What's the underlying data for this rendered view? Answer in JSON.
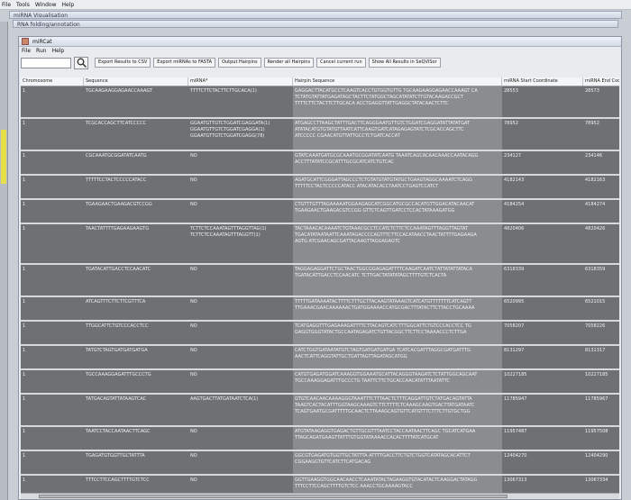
{
  "outer_window": {
    "title": "sRNA Workbench",
    "menu": [
      "File",
      "Tools",
      "Window",
      "Help"
    ],
    "bg_windows": [
      "miRNA Visualisation",
      "RNA folding/annotation"
    ]
  },
  "main_window": {
    "title": "miRCat",
    "menu": [
      "File",
      "Run",
      "Help"
    ],
    "search": {
      "placeholder": "",
      "value": ""
    },
    "toolbar": [
      "Export Results to CSV",
      "Export miRNAs to FASTA",
      "Output Hairpins",
      "Render all Hairpins",
      "Cancel current run",
      "Show All Results in SeQVISor"
    ]
  },
  "table": {
    "columns": [
      "Chromosome",
      "Sequence",
      "miRNA*",
      "Hairpin Sequence",
      "miRNA Start Coordinate",
      "miRNA End Coord"
    ],
    "rows": [
      {
        "chrom": "1",
        "seq": "TGCAAGAAGGAGAACCAAAGT",
        "star": [
          "TTTTCTTCTACTTCTTGCACA(1)"
        ],
        "hairpin": [
          "GAGGACTTACATGCCTCAAGTCACCTGTGGTGTTG TGCAAGAAGGAGAACCAAAGT CA",
          "TCTATGTATTATGAGATAGCTACTTCTATGGCTAGCATATATCTTGTACAAGACCGCT",
          "TTTTCTTCTACTTCTTGCACA ACCTGAGGTTATTGAGGCTATACAACTCTTC"
        ],
        "start": "28553",
        "end": "28573"
      },
      {
        "chrom": "1",
        "seq": "TCGCACCAGCTTCATCCCCC",
        "star": [
          "GGAATGTTGTCTGGATCGAGGATA(1)",
          "GGAATGTTGTCTGGATCGAGGA(1)",
          "GGAATGTTGTCTGGATCGAGG(78)"
        ],
        "hairpin": [
          "ATGAGCCTTAAGCTATTTGACTTCAGGGAATGTTGTCTGGATCGAGGATATTATATGAT",
          "ATATACATGTGTATGTTAATCATTCAAGTGATCATAGAGAGTATCTCGCACCAGCTTC",
          "ATCCCCC CGAACATGTTATTGCCTCTGATCACCAT"
        ],
        "start": "78952",
        "end": "78952"
      },
      {
        "chrom": "1",
        "seq": "CGCAAATGCGGATATCAATG",
        "star": [
          "NO"
        ],
        "hairpin": [
          "GTATCAAATGATGCGCAAATGCGGATATCAATG TAAATCAGCACAACAAACCAATACAGG",
          "ACCTTTATATCCGCATTTGCGCATCATCTGTCAC"
        ],
        "start": "234127",
        "end": "234146"
      },
      {
        "chrom": "1",
        "seq": "TTTTTCCTACTCCCCCATACC",
        "star": [
          "NO"
        ],
        "hairpin": [
          "AGATGCATTCGGGATTAGCCCTCTGTATGTATGTATGCTGAAGTAGGCAAAATCTCAGG",
          "TTTTTCCTACTCCCCCATACC ATACATACACCTAATCCTGAGTCCATCT"
        ],
        "start": "4182143",
        "end": "4182163"
      },
      {
        "chrom": "1",
        "seq": "TGAAGAACTGAAGACGTCCGG",
        "star": [
          "NO"
        ],
        "hairpin": [
          "CTGTTTGTTTAGAAAAATGGAAGAGCATCGGCATGCGCCACATGTTGGACATACAACAT",
          "TGAAGAACTGAAGACGTCCGG GTTCTCAGTTGATCCTCCACTATAAAGATGG"
        ],
        "start": "4184254",
        "end": "4184274"
      },
      {
        "chrom": "1",
        "seq": "TAACTATTTTGAGAAGAAGTG",
        "star": [
          "TCTTCTCCAAATAGTTTAGGTTAG(1)",
          "TCTTCTCCAAATAGTTTAGGTT(1)"
        ],
        "hairpin": [
          "TACTAAACACAAAATCTGTAAACGCCTCCATCTCTTCTCCAAATAGTTTAGGTTAGTAT",
          "TGACATATAATAATTCAAATAGACCCCAGTTTCTTCCACATAACCTAACTATTTTGAGAAGA",
          "AGTG ATCGAACAGCGATTACAAGTTAGGAGAGTC"
        ],
        "start": "4820406",
        "end": "4820426"
      },
      {
        "chrom": "1",
        "seq": "TGATACATTGACCTCCAACATC",
        "star": [
          "NO"
        ],
        "hairpin": [
          "TAGGAGAGGATTCTGCTAACTGGCGGAGAGATTTTCAAGATCAATCTATTATATTATACA",
          "TGATACATTGACCTCCAACATC TCTTGACTATATATAGCTTTTGTCTCACTA"
        ],
        "start": "6318339",
        "end": "6318359"
      },
      {
        "chrom": "1",
        "seq": "ATCAGTTTCTTCTTCGTTTCA",
        "star": [
          "NO"
        ],
        "hairpin": [
          "TTTTTGATAAAATACTTTTCTTTGCTTACAAGTATAAAGTCATCATGTTTTTTTCATCAGTT",
          "TTGAAACGAACAAAAAACTGATGGAAAACCATGCGACTTTATACTTCTTACCTGCAAAA"
        ],
        "start": "6520995",
        "end": "6521015"
      },
      {
        "chrom": "1",
        "seq": "TTGGCATTCTGTCCCACCTCC",
        "star": [
          "NO"
        ],
        "hairpin": [
          "TCATGAGGTTTGAGAAAGATTTTCTTACAGTCATCTTTGGCATTCTGTCCCACCTCC TG",
          "GAGGTGGGTATACTGCCAATAGAGATCTGTTACGGCTTCTTCCTAAAACCCTCTTGA"
        ],
        "start": "7058207",
        "end": "7058226"
      },
      {
        "chrom": "1",
        "seq": "TATGTCTAGTGATGATGATGA",
        "star": [
          "NO"
        ],
        "hairpin": [
          "CATCTGGTGATAATATGTCTAGTGATGATGATGA TCATCACGATTTAGGCGATGATTTG",
          "AACTCATTCAGGTATTGCTGATTAGTTAGATAGCATGG"
        ],
        "start": "8131297",
        "end": "8131317"
      },
      {
        "chrom": "1",
        "seq": "TGCCAAAGGAGATTTGCCCTG",
        "star": [
          "NO"
        ],
        "hairpin": [
          "CATGTGAGATGGATCAAAGGTGGAAATGCATTACAGGGTAAGATCTCTATTGGCAGCAAT",
          "TGCCAAAGGAGATTTGCCCTG TAATTCTTCTGCACCAACATATTTAATATTC"
        ],
        "start": "10227185",
        "end": "10227185"
      },
      {
        "chrom": "1",
        "seq": "TATGACAGTATTATAAGTCAC",
        "star": [
          "AAGTGACTTATGATAATCTCA(1)"
        ],
        "hairpin": [
          "GTGTCAACAACAAAAGGGTAAATTTCTTTAACTCTTTCAGGATTGTCTATGACAGTATTA",
          "TAAGTCACTACATTTGGTAAGCAAAGTCTTCTTTTCTCAAAGCAAGTGACTTATGATAATC",
          "TCAGTGAATGCGATTTTTGCAACTCTTAAAGCAGTGTTCATGTTTCTTTCTTGTGCTGG"
        ],
        "start": "11785947",
        "end": "11785967"
      },
      {
        "chrom": "1",
        "seq": "TAATCCTACCAATAACTTCAGC",
        "star": [
          "NO"
        ],
        "hairpin": [
          "ATGTATAAGAGGTGAGACTGTTGCGTTTAATCCTACCAATAACTTCAGC TGCATCATGAA",
          "TTAGCAGATGAAGTTATTTGTGGTATAAAACCACACTTTTATCATGCAT"
        ],
        "start": "11957487",
        "end": "11957508"
      },
      {
        "chrom": "1",
        "seq": "TGAGATGTGGTTGCTATTTA",
        "star": [
          "NO"
        ],
        "hairpin": [
          "GGCGTGAGATGTGGTTGCTATTTA ATTTTGACCTTCTGTCTGGTCATATAGCACATTCT",
          "CGGAAGGTGTTCATCTTCATGACAG"
        ],
        "start": "12404270",
        "end": "12404290"
      },
      {
        "chrom": "1",
        "seq": "TTTCCTTCCAGCTTTTGTCTCC",
        "star": [
          "NO"
        ],
        "hairpin": [
          "GGTTGAAGGTGGCAACAACCTCAAATATACTAGAAGGTGTACATACTCAAGGACTATAGG",
          "TTTCCTTCCAGCTTTTGTCTCC AAACCTGCAAAAGTACC"
        ],
        "start": "13067313",
        "end": "13067334"
      }
    ]
  }
}
